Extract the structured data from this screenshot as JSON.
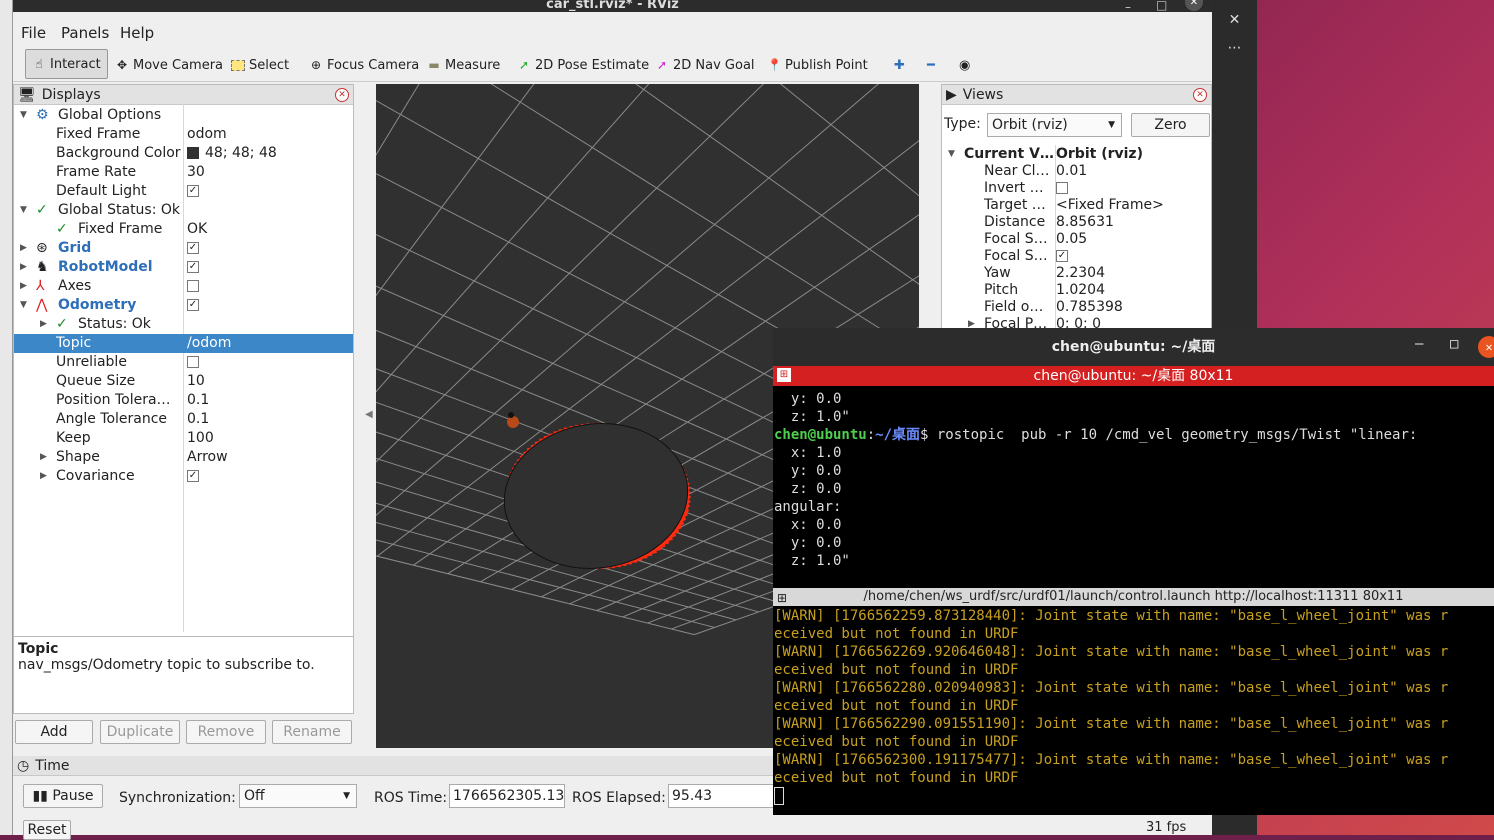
{
  "window_title": "car_stl.rviz* - RViz",
  "menu": [
    "File",
    "Panels",
    "Help"
  ],
  "toolbar": {
    "interact": "Interact",
    "move_camera": "Move Camera",
    "select": "Select",
    "focus_camera": "Focus Camera",
    "measure": "Measure",
    "pose_estimate": "2D Pose Estimate",
    "nav_goal": "2D Nav Goal",
    "publish_point": "Publish Point"
  },
  "displays": {
    "title": "Displays",
    "rows": [
      {
        "label": "Global Options",
        "value": ""
      },
      {
        "label": "Fixed Frame",
        "value": "odom"
      },
      {
        "label": "Background Color",
        "value": "48; 48; 48"
      },
      {
        "label": "Frame Rate",
        "value": "30"
      },
      {
        "label": "Default Light",
        "value": "✓"
      },
      {
        "label": "Global Status: Ok",
        "value": ""
      },
      {
        "label": "Fixed Frame",
        "value": "OK"
      },
      {
        "label": "Grid",
        "value": "✓"
      },
      {
        "label": "RobotModel",
        "value": "✓"
      },
      {
        "label": "Axes",
        "value": ""
      },
      {
        "label": "Odometry",
        "value": "✓"
      },
      {
        "label": "Status: Ok",
        "value": ""
      },
      {
        "label": "Topic",
        "value": "/odom"
      },
      {
        "label": "Unreliable",
        "value": ""
      },
      {
        "label": "Queue Size",
        "value": "10"
      },
      {
        "label": "Position Tolera…",
        "value": "0.1"
      },
      {
        "label": "Angle Tolerance",
        "value": "0.1"
      },
      {
        "label": "Keep",
        "value": "100"
      },
      {
        "label": "Shape",
        "value": "Arrow"
      },
      {
        "label": "Covariance",
        "value": "✓"
      }
    ],
    "desc_title": "Topic",
    "desc_text": "nav_msgs/Odometry topic to subscribe to.",
    "buttons": {
      "add": "Add",
      "duplicate": "Duplicate",
      "remove": "Remove",
      "rename": "Rename"
    }
  },
  "views": {
    "title": "Views",
    "type_label": "Type:",
    "type_value": "Orbit (rviz)",
    "zero": "Zero",
    "rows": [
      {
        "label": "Current V…",
        "value": "Orbit (rviz)"
      },
      {
        "label": "Near Cl…",
        "value": "0.01"
      },
      {
        "label": "Invert …",
        "value": ""
      },
      {
        "label": "Target …",
        "value": "<Fixed Frame>"
      },
      {
        "label": "Distance",
        "value": "8.85631"
      },
      {
        "label": "Focal S…",
        "value": "0.05"
      },
      {
        "label": "Focal S…",
        "value": "✓"
      },
      {
        "label": "Yaw",
        "value": "2.2304"
      },
      {
        "label": "Pitch",
        "value": "1.0204"
      },
      {
        "label": "Field o…",
        "value": "0.785398"
      },
      {
        "label": "Focal P…",
        "value": "0; 0; 0"
      }
    ]
  },
  "time": {
    "title": "Time",
    "pause": "Pause",
    "sync_label": "Synchronization:",
    "sync_value": "Off",
    "ros_time_label": "ROS Time:",
    "ros_time": "1766562305.13",
    "ros_elapsed_label": "ROS Elapsed:",
    "ros_elapsed": "95.43",
    "reset": "Reset",
    "fps": "31 fps"
  },
  "terminal": {
    "title": "chen@ubuntu: ~/桌面",
    "tab1": "chen@ubuntu: ~/桌面 80x11",
    "tab2": "/home/chen/ws_urdf/src/urdf01/launch/control.launch http://localhost:11311 80x11",
    "prompt_user": "chen@ubuntu",
    "prompt_path": "~/桌面",
    "command": "$ rostopic  pub -r 10 /cmd_vel geometry_msgs/Twist \"linear:",
    "top_lines": [
      "  y: 0.0",
      "  z: 1.0\""
    ],
    "mid_lines": [
      "  x: 1.0",
      "  y: 0.0",
      "  z: 0.0",
      "angular:",
      "  x: 0.0",
      "  y: 0.0",
      "  z: 1.0\""
    ],
    "warn_lines": [
      "[WARN] [1766562259.873128440]: Joint state with name: \"base_l_wheel_joint\" was r",
      "eceived but not found in URDF",
      "[WARN] [1766562269.920646048]: Joint state with name: \"base_l_wheel_joint\" was r",
      "eceived but not found in URDF",
      "[WARN] [1766562280.020940983]: Joint state with name: \"base_l_wheel_joint\" was r",
      "eceived but not found in URDF",
      "[WARN] [1766562290.091551190]: Joint state with name: \"base_l_wheel_joint\" was r",
      "eceived but not found in URDF",
      "[WARN] [1766562300.191175477]: Joint state with name: \"base_l_wheel_joint\" was r",
      "eceived but not found in URDF"
    ]
  },
  "colors": {
    "arrow": "#ff2a10",
    "selection": "#3b87c8",
    "terminal_tab": "#d42020"
  }
}
